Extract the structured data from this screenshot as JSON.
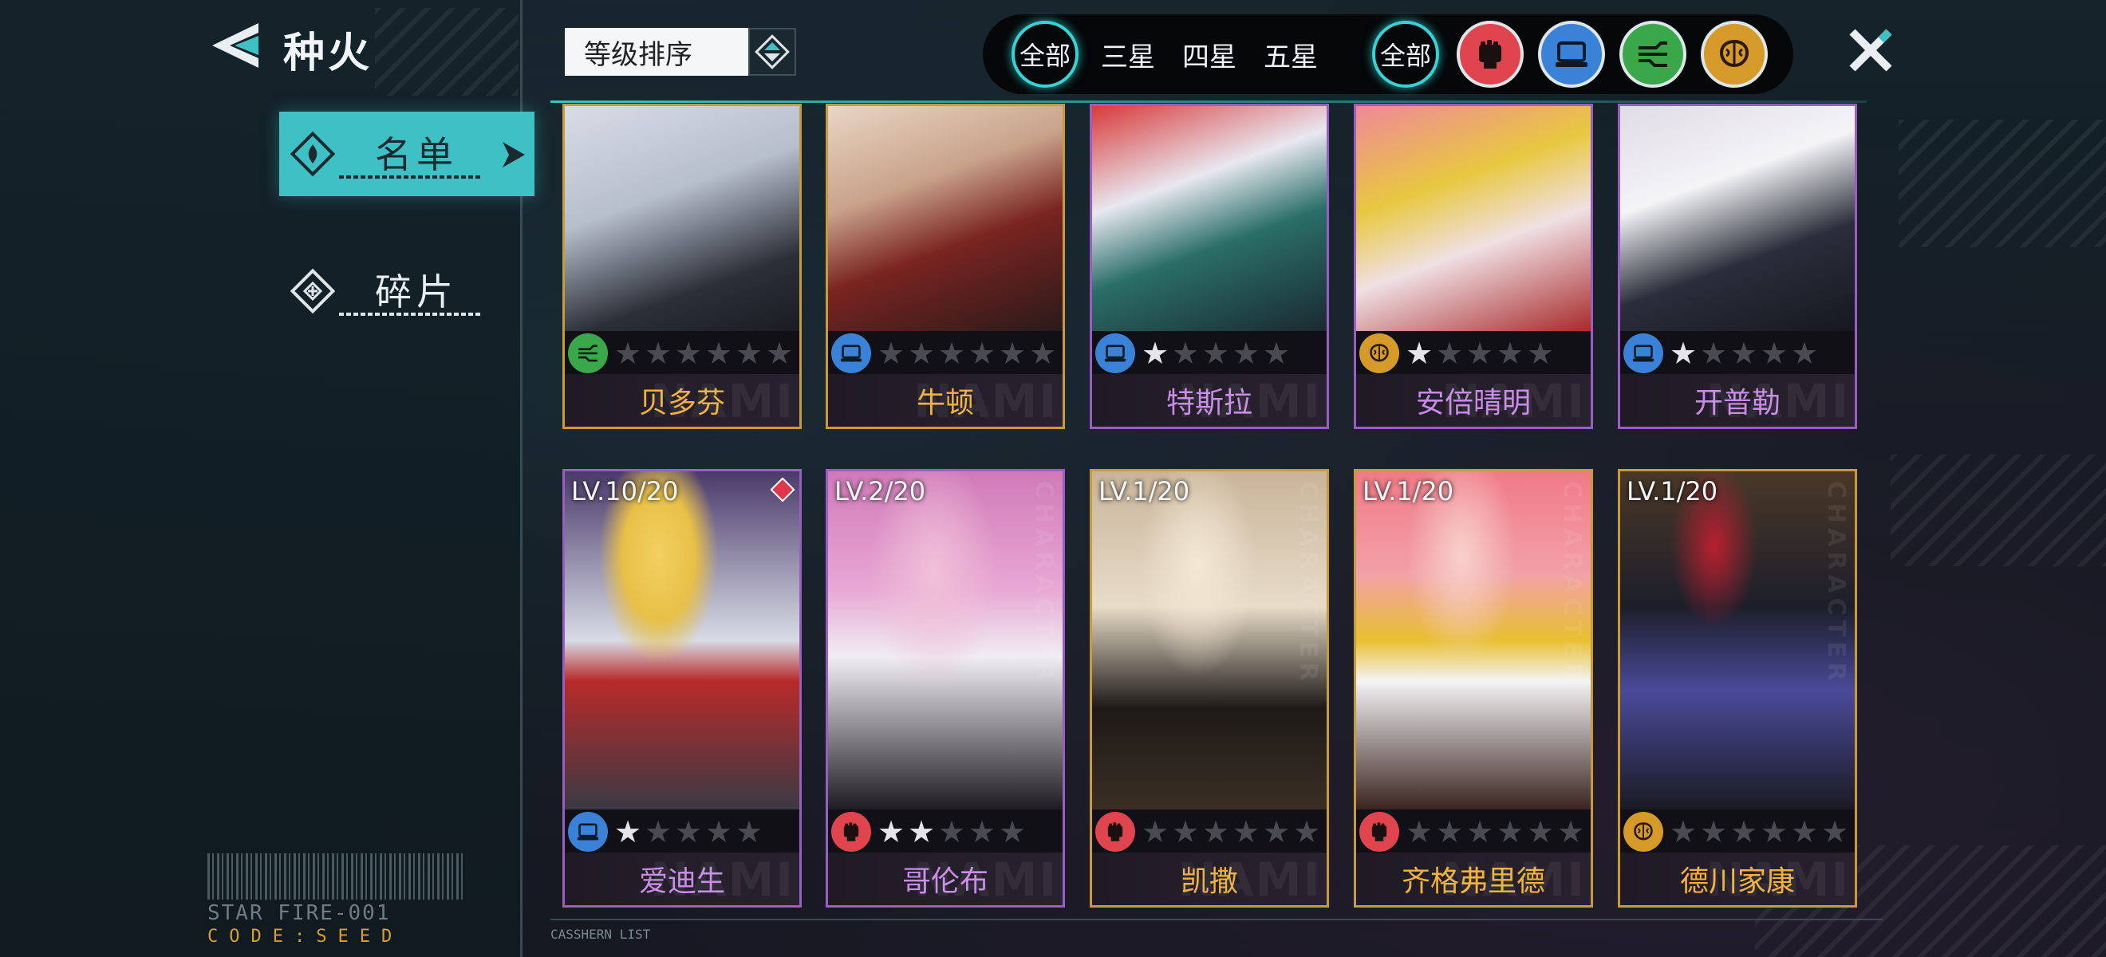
{
  "header": {
    "title": "种火"
  },
  "sidebar": {
    "items": [
      {
        "label": "名单",
        "active": true
      },
      {
        "label": "碎片",
        "active": false
      }
    ]
  },
  "brand": {
    "name": "STAR FIRE-001",
    "code": "CODE:SEED"
  },
  "sort": {
    "label": "等级排序"
  },
  "filters": {
    "stars": [
      "全部",
      "三星",
      "四星",
      "五星"
    ],
    "stars_selected": "全部",
    "type_all": "全部",
    "types": [
      "fist-icon",
      "chip-icon",
      "circuit-icon",
      "brain-icon"
    ]
  },
  "footer": {
    "label": "CASSHERN LIST"
  },
  "colors": {
    "accent": "#3fc0c4",
    "gold": "#c89a3a",
    "purple": "#9a5ec2",
    "fist": "#e0444e",
    "chip": "#3a82d8",
    "circuit": "#3aa84a",
    "brain": "#d69a2a"
  },
  "cards_top": [
    {
      "name": "贝多芬",
      "type": "circuit",
      "stars_total": 6,
      "stars_lit": 0,
      "frame": "gold"
    },
    {
      "name": "牛顿",
      "type": "chip",
      "stars_total": 6,
      "stars_lit": 0,
      "frame": "gold"
    },
    {
      "name": "特斯拉",
      "type": "chip",
      "stars_total": 5,
      "stars_lit": 1,
      "frame": "purple"
    },
    {
      "name": "安倍晴明",
      "type": "brain",
      "stars_total": 5,
      "stars_lit": 1,
      "frame": "purple"
    },
    {
      "name": "开普勒",
      "type": "chip",
      "stars_total": 5,
      "stars_lit": 1,
      "frame": "purple"
    }
  ],
  "cards_bottom": [
    {
      "name": "爱迪生",
      "level": "LV.10/20",
      "type": "chip",
      "stars_total": 5,
      "stars_lit": 1,
      "frame": "purple"
    },
    {
      "name": "哥伦布",
      "level": "LV.2/20",
      "type": "fist",
      "stars_total": 5,
      "stars_lit": 2,
      "frame": "purple"
    },
    {
      "name": "凯撒",
      "level": "LV.1/20",
      "type": "fist",
      "stars_total": 6,
      "stars_lit": 0,
      "frame": "gold"
    },
    {
      "name": "齐格弗里德",
      "level": "LV.1/20",
      "type": "fist",
      "stars_total": 6,
      "stars_lit": 0,
      "frame": "gold"
    },
    {
      "name": "德川家康",
      "level": "LV.1/20",
      "type": "brain",
      "stars_total": 6,
      "stars_lit": 0,
      "frame": "gold"
    }
  ]
}
